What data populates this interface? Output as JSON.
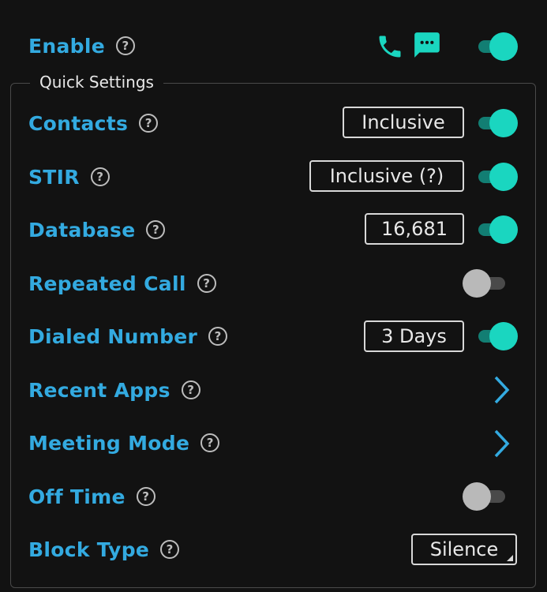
{
  "enable": {
    "label": "Enable",
    "help": "?"
  },
  "quick_settings": {
    "title": "Quick Settings"
  },
  "rows": [
    {
      "label": "Contacts",
      "help": "?",
      "value": "Inclusive",
      "toggle": "on"
    },
    {
      "label": "STIR",
      "help": "?",
      "value": "Inclusive (?)",
      "toggle": "on"
    },
    {
      "label": "Database",
      "help": "?",
      "value": "16,681",
      "toggle": "on"
    },
    {
      "label": "Repeated Call",
      "help": "?",
      "toggle": "off"
    },
    {
      "label": "Dialed Number",
      "help": "?",
      "value": "3 Days",
      "toggle": "on"
    },
    {
      "label": "Recent Apps",
      "help": "?",
      "control": "chevron-right"
    },
    {
      "label": "Meeting Mode",
      "help": "?",
      "control": "chevron-right"
    },
    {
      "label": "Off Time",
      "help": "?",
      "toggle": "off"
    },
    {
      "label": "Block Type",
      "help": "?",
      "value": "Silence",
      "control": "dropdown"
    }
  ],
  "icons": {
    "phone": "phone-icon",
    "message": "message-icon"
  },
  "colors": {
    "accent": "#1ad6c0",
    "label": "#33aae0",
    "background": "#121212"
  }
}
